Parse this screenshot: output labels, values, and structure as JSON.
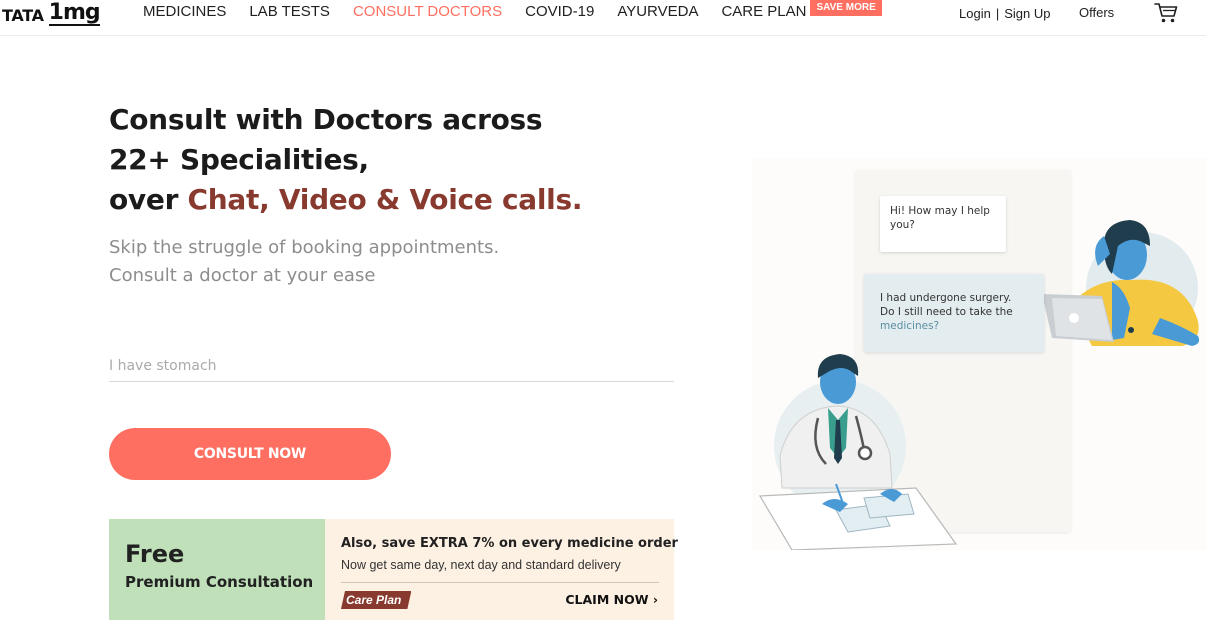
{
  "header": {
    "logo": {
      "brand": "TATA",
      "product": "1mg"
    },
    "nav": [
      {
        "label": "MEDICINES",
        "active": false
      },
      {
        "label": "LAB TESTS",
        "active": false
      },
      {
        "label": "CONSULT DOCTORS",
        "active": true
      },
      {
        "label": "COVID-19",
        "active": false
      },
      {
        "label": "AYURVEDA",
        "active": false
      },
      {
        "label": "CARE PLAN",
        "active": false
      }
    ],
    "save_badge": "SAVE MORE",
    "login": "Login",
    "separator": "|",
    "signup": "Sign Up",
    "offers": "Offers",
    "cart_icon": "cart-icon"
  },
  "hero": {
    "headline_line1": "Consult with Doctors across 22+ Specialities,",
    "headline_prefix": "over",
    "headline_accent": "Chat, Video & Voice calls.",
    "subline_1": "Skip the struggle of booking appointments.",
    "subline_2": "Consult a doctor at your ease",
    "search": {
      "value": "",
      "placeholder": "I have stomach"
    },
    "cta_label": "CONSULT NOW"
  },
  "promo": {
    "free": "Free",
    "premium": "Premium Consultation",
    "title": "Also, save EXTRA 7% on every medicine order",
    "subtitle": "Now get same day, next day and standard delivery",
    "tag": "Care Plan",
    "claim": "CLAIM NOW ›"
  },
  "illustration": {
    "doctor_message": "Hi! How may I help you?",
    "patient_message_main": "I had undergone surgery. Do I still need to take the",
    "patient_message_end": "medicines?"
  },
  "colors": {
    "accent": "#ff6f61",
    "headline_accent": "#893a2e",
    "promo_green": "#bfe0b9",
    "promo_cream": "#fdf1e3",
    "figure_blue": "#4a9ad6"
  }
}
